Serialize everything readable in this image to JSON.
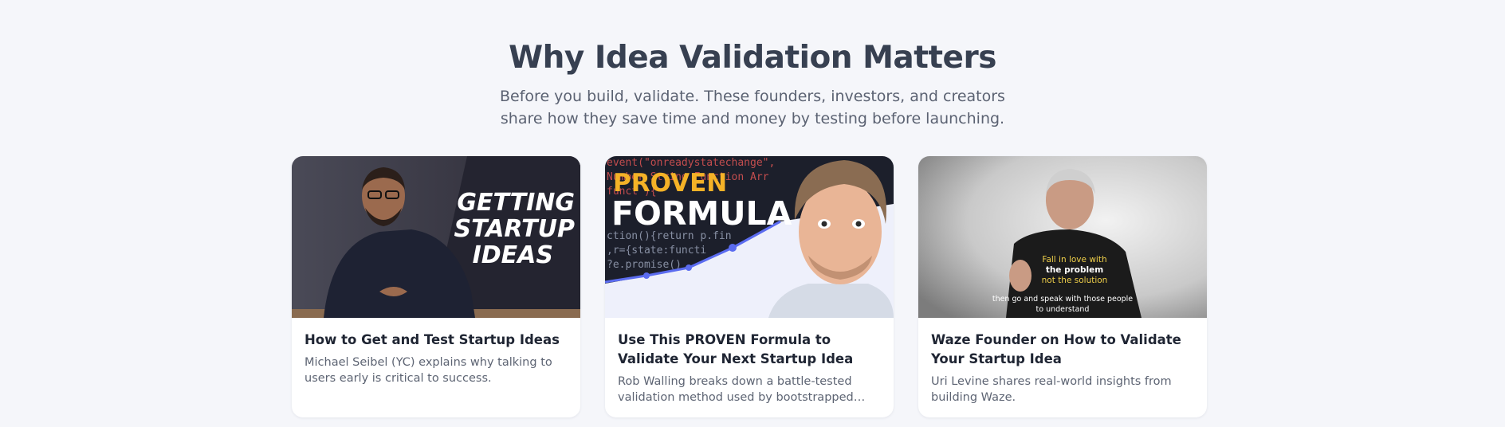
{
  "section": {
    "title": "Why Idea Validation Matters",
    "subtitle": "Before you build, validate. These founders, investors, and creators share how they save time and money by testing before launching."
  },
  "cards": [
    {
      "title": "How to Get and Test Startup Ideas",
      "description": "Michael Seibel (YC) explains why talking to users early is critical to success.",
      "thumbnail": {
        "lines": [
          "GETTING",
          "STARTUP",
          "IDEAS"
        ]
      }
    },
    {
      "title": "Use This PROVEN Formula to Validate Your Next Startup Idea",
      "description": "Rob Walling breaks down a battle-tested validation method used by bootstrapped founders.",
      "thumbnail": {
        "headline_1": "PROVEN",
        "headline_2": "FORMULA",
        "code_lines": [
          "event(\"onreadystatechange\",",
          "Number String Function Arr",
          "funct                   ){",
          "ction(){return p.fin",
          ",r={state:functi",
          "?e.promise()"
        ]
      }
    },
    {
      "title": "Waze Founder on How to Validate Your Startup Idea",
      "description": "Uri Levine shares real-world insights from building Waze.",
      "thumbnail": {
        "shirt_lines": [
          "Fall in love with",
          "the problem",
          "not the solution"
        ],
        "caption_lines": [
          "then go and speak with those people",
          "to understand"
        ]
      }
    }
  ],
  "colors": {
    "background": "#f5f6fa",
    "title": "#374051",
    "accent_yellow": "#f4b227",
    "chart_line": "#5b6cf0"
  },
  "icons": {
    "thumbnails": [
      "video-thumbnail",
      "video-thumbnail",
      "video-thumbnail"
    ]
  }
}
